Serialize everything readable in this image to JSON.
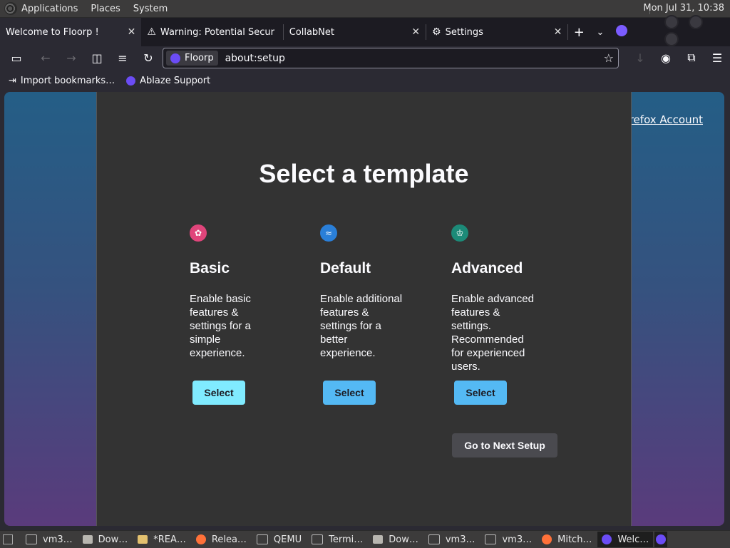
{
  "panel": {
    "menus": [
      "Applications",
      "Places",
      "System"
    ],
    "clock": "Mon Jul 31, 10:38"
  },
  "tabs": [
    {
      "title": "Welcome to Floorp !",
      "icon": "",
      "active": true
    },
    {
      "title": "Warning: Potential Secur",
      "icon": "warning-icon"
    },
    {
      "title": "CollabNet",
      "icon": ""
    },
    {
      "title": "Settings",
      "icon": "gear-icon"
    }
  ],
  "navbar": {
    "identity_label": "Floorp",
    "url": "about:setup"
  },
  "bookmarks": [
    {
      "label": "Import bookmarks…",
      "icon": "import-icon"
    },
    {
      "label": "Ablaze Support",
      "icon": "floorp-icon"
    }
  ],
  "page": {
    "account_link": "Firefox Account",
    "title": "Select a template",
    "templates": [
      {
        "name": "Basic",
        "description": "Enable basic features & settings for a simple experience.",
        "button": "Select",
        "color": "#e0457b",
        "icon": "flower-icon"
      },
      {
        "name": "Default",
        "description": "Enable additional features & settings for a better experience.",
        "button": "Select",
        "color": "#2a7fd8",
        "icon": "wave-icon"
      },
      {
        "name": "Advanced",
        "description": "Enable advanced features & settings. Recommended for experienced users.",
        "button": "Select",
        "color": "#1c8a78",
        "icon": "crown-icon"
      }
    ],
    "next_button": "Go to Next Setup"
  },
  "taskbar": [
    {
      "label": "vm3…",
      "icon": "terminal-icon"
    },
    {
      "label": "Dow…",
      "icon": "folder-icon"
    },
    {
      "label": "*REA…",
      "icon": "editor-icon"
    },
    {
      "label": "Relea…",
      "icon": "firefox-icon"
    },
    {
      "label": "QEMU",
      "icon": "terminal-icon"
    },
    {
      "label": "Termi…",
      "icon": "terminal-icon"
    },
    {
      "label": "Dow…",
      "icon": "folder-icon"
    },
    {
      "label": "vm3…",
      "icon": "terminal-icon"
    },
    {
      "label": "vm3…",
      "icon": "terminal-icon"
    },
    {
      "label": "Mitch…",
      "icon": "firefox-icon"
    },
    {
      "label": "Welc…",
      "icon": "floorp-icon",
      "active": true
    }
  ]
}
